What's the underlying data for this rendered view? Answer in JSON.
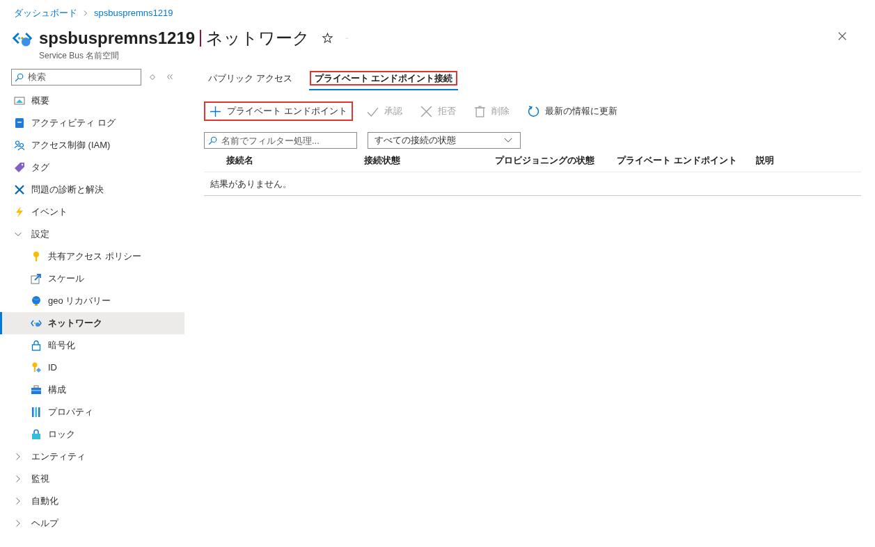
{
  "breadcrumb": [
    {
      "label": "ダッシュボード"
    },
    {
      "label": "spsbuspremns1219"
    }
  ],
  "header": {
    "resource": "spsbuspremns1219",
    "page": "ネットワーク",
    "subtitle": "Service Bus 名前空間"
  },
  "sidebar": {
    "search": {
      "placeholder": "検索"
    },
    "items": [
      {
        "label": "概要",
        "kind": "item",
        "selected": false
      },
      {
        "label": "アクティビティ ログ",
        "kind": "item",
        "selected": false
      },
      {
        "label": "アクセス制御 (IAM)",
        "kind": "item",
        "selected": false
      },
      {
        "label": "タグ",
        "kind": "item",
        "selected": false
      },
      {
        "label": "問題の診断と解決",
        "kind": "item",
        "selected": false
      },
      {
        "label": "イベント",
        "kind": "item",
        "selected": false
      },
      {
        "label": "設定",
        "kind": "group",
        "expanded": true,
        "children": [
          {
            "label": "共有アクセス ポリシー",
            "selected": false
          },
          {
            "label": "スケール",
            "selected": false
          },
          {
            "label": "geo リカバリー",
            "selected": false
          },
          {
            "label": "ネットワーク",
            "selected": true
          },
          {
            "label": "暗号化",
            "selected": false
          },
          {
            "label": "ID",
            "selected": false
          },
          {
            "label": "構成",
            "selected": false
          },
          {
            "label": "プロパティ",
            "selected": false
          },
          {
            "label": "ロック",
            "selected": false
          }
        ]
      },
      {
        "label": "エンティティ",
        "kind": "group",
        "expanded": false
      },
      {
        "label": "監視",
        "kind": "group",
        "expanded": false
      },
      {
        "label": "自動化",
        "kind": "group",
        "expanded": false
      },
      {
        "label": "ヘルプ",
        "kind": "group",
        "expanded": false
      }
    ]
  },
  "tabs": [
    {
      "label": "パブリック アクセス",
      "selected": false,
      "highlighted": false
    },
    {
      "label": "プライベート エンドポイント接続",
      "selected": true,
      "highlighted": true
    }
  ],
  "toolbar": [
    {
      "label": "プライベート エンドポイント",
      "disabled": false,
      "highlighted": true
    },
    {
      "label": "承認",
      "disabled": true,
      "highlighted": false
    },
    {
      "label": "拒否",
      "disabled": true,
      "highlighted": false
    },
    {
      "label": "削除",
      "disabled": true,
      "highlighted": false
    },
    {
      "label": "最新の情報に更新",
      "disabled": false,
      "highlighted": false
    }
  ],
  "filter": {
    "placeholder": "名前でフィルター処理...",
    "dropdown": "すべての接続の状態"
  },
  "table": {
    "columns": [
      "接続名",
      "接続状態",
      "プロビジョニングの状態",
      "プライベート エンドポイント",
      "説明"
    ],
    "empty_message": "結果がありません。"
  }
}
